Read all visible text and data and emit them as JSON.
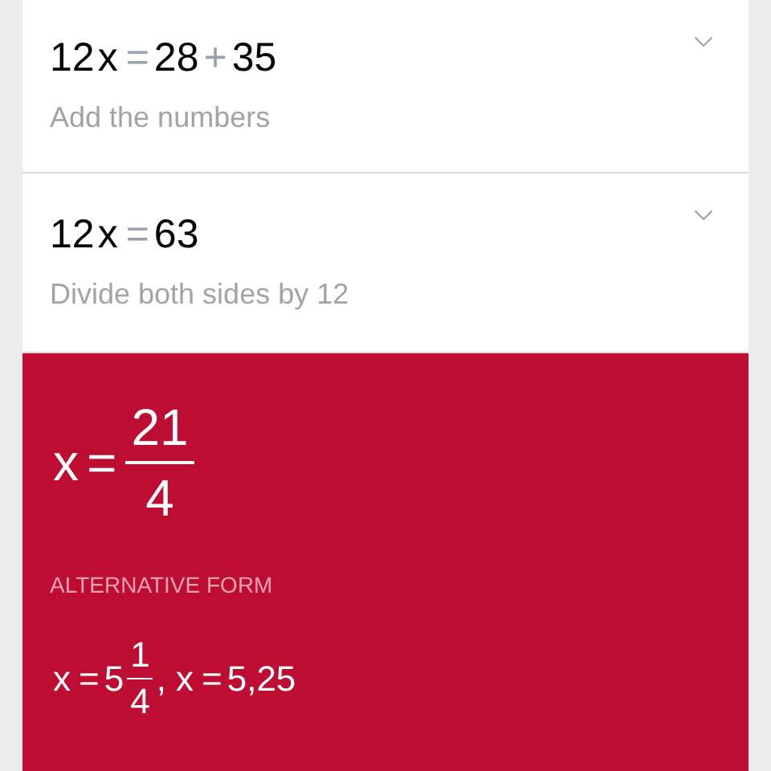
{
  "steps": [
    {
      "expression": [
        {
          "kind": "num",
          "text": "12"
        },
        {
          "kind": "var",
          "text": "x"
        },
        {
          "kind": "op",
          "text": "="
        },
        {
          "kind": "num",
          "text": "28"
        },
        {
          "kind": "op",
          "text": "+"
        },
        {
          "kind": "num",
          "text": "35"
        }
      ],
      "hint": "Add the numbers",
      "expanded": false
    },
    {
      "expression": [
        {
          "kind": "num",
          "text": "12"
        },
        {
          "kind": "var",
          "text": "x"
        },
        {
          "kind": "op",
          "text": "="
        },
        {
          "kind": "num",
          "text": "63"
        }
      ],
      "hint": "Divide both sides by 12",
      "expanded": false
    }
  ],
  "result": {
    "expression": [
      {
        "kind": "var",
        "text": "x"
      },
      {
        "kind": "op",
        "text": "="
      },
      {
        "kind": "frac",
        "numerator": "21",
        "denominator": "4"
      }
    ],
    "alternative_label": "ALTERNATIVE FORM",
    "alternative": [
      {
        "kind": "var",
        "text": "x"
      },
      {
        "kind": "op",
        "text": "="
      },
      {
        "kind": "num",
        "text": "5"
      },
      {
        "kind": "frac",
        "numerator": "1",
        "denominator": "4"
      },
      {
        "kind": "sep",
        "text": ","
      },
      {
        "kind": "var",
        "text": "x"
      },
      {
        "kind": "op",
        "text": "="
      },
      {
        "kind": "num",
        "text": "5,25"
      }
    ]
  }
}
